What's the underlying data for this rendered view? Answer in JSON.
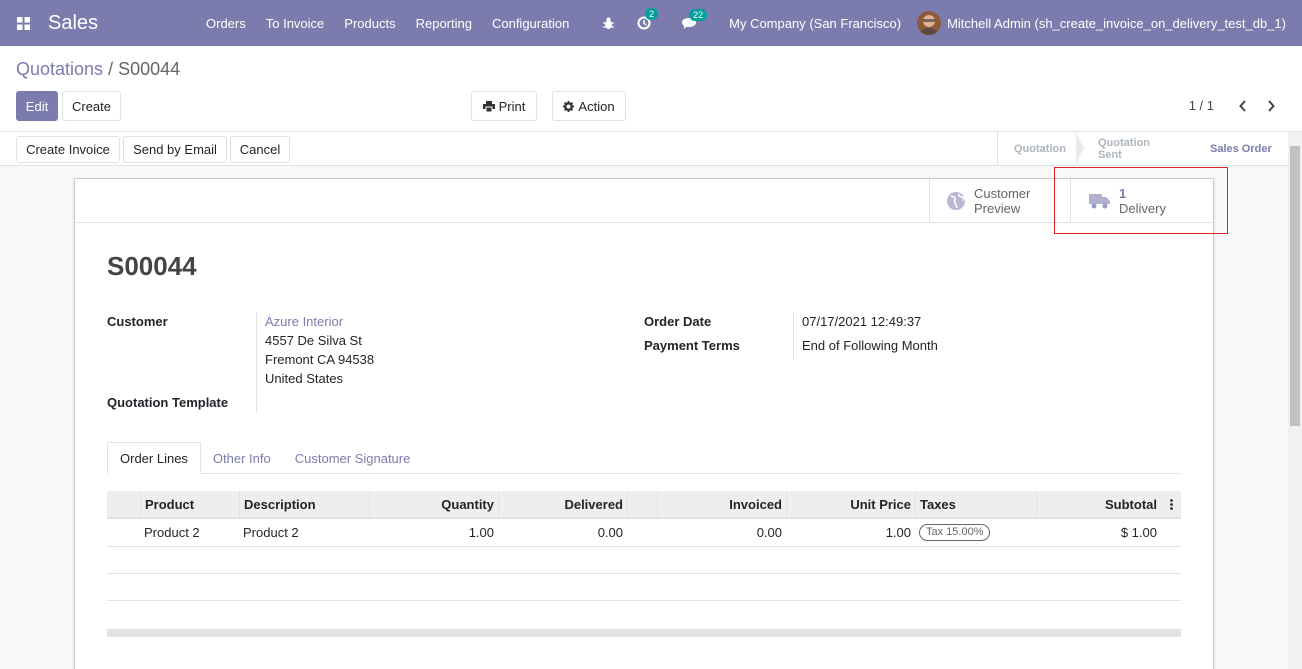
{
  "navbar": {
    "app_name": "Sales",
    "menu": [
      "Orders",
      "To Invoice",
      "Products",
      "Reporting",
      "Configuration"
    ],
    "activity_count": "2",
    "messages_count": "22",
    "company": "My Company (San Francisco)",
    "user": "Mitchell Admin (sh_create_invoice_on_delivery_test_db_1)"
  },
  "breadcrumb": {
    "parent": "Quotations",
    "separator": "/",
    "current": "S00044"
  },
  "actions": {
    "edit": "Edit",
    "create": "Create",
    "print": "Print",
    "action": "Action"
  },
  "pager": {
    "value": "1 / 1"
  },
  "header_buttons": {
    "create_invoice": "Create Invoice",
    "send_email": "Send by Email",
    "cancel": "Cancel"
  },
  "stages": [
    "Quotation",
    "Quotation Sent",
    "Sales Order"
  ],
  "smart_buttons": {
    "preview_line1": "Customer",
    "preview_line2": "Preview",
    "delivery_count": "1",
    "delivery_label": "Delivery"
  },
  "record": {
    "name": "S00044",
    "customer_label": "Customer",
    "customer_name": "Azure Interior",
    "address1": "4557 De Silva St",
    "address2": "Fremont CA 94538",
    "address3": "United States",
    "template_label": "Quotation Template",
    "order_date_label": "Order Date",
    "order_date": "07/17/2021 12:49:37",
    "payment_terms_label": "Payment Terms",
    "payment_terms": "End of Following Month"
  },
  "tabs": [
    "Order Lines",
    "Other Info",
    "Customer Signature"
  ],
  "lines": {
    "headers": [
      "Product",
      "Description",
      "Quantity",
      "Delivered",
      "Invoiced",
      "Unit Price",
      "Taxes",
      "Subtotal"
    ],
    "rows": [
      {
        "product": "Product 2",
        "description": "Product 2",
        "quantity": "1.00",
        "delivered": "0.00",
        "invoiced": "0.00",
        "unit_price": "1.00",
        "tax": "Tax 15.00%",
        "subtotal": "$ 1.00"
      }
    ]
  }
}
